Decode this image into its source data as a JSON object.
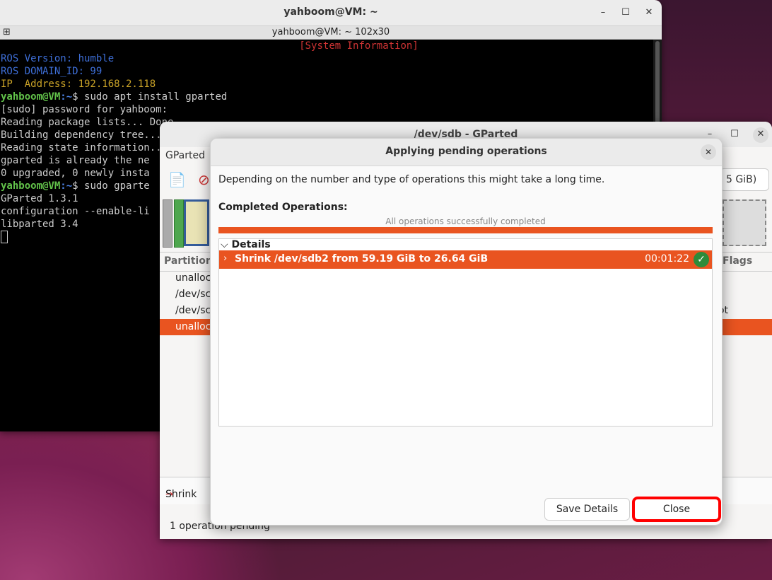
{
  "terminal": {
    "window_title": "yahboom@VM: ~",
    "tab_title": "yahboom@VM: ~ 102x30",
    "window_controls": {
      "minimize": "–",
      "maximize": "☐",
      "close": "✕"
    },
    "lines": {
      "sys_info": "[System Information]",
      "ros_version": "ROS Version: humble",
      "ros_domain": "ROS DOMAIN_ID: 99",
      "ip": "IP  Address: 192.168.2.118",
      "prompt1_user": "yahboom@VM",
      "prompt1_path": ":~",
      "prompt1_cmd": "$ sudo apt install gparted",
      "l1": "[sudo] password for yahboom:",
      "l2": "Reading package lists... Done",
      "l3": "Building dependency tree...",
      "l4": "Reading state information...",
      "l5": "gparted is already the ne",
      "l6": "0 upgraded, 0 newly insta",
      "prompt2_user": "yahboom@VM",
      "prompt2_path": ":~",
      "prompt2_cmd": "$ sudo gparte",
      "l7": "GParted 1.3.1",
      "l8": "configuration --enable-li",
      "l9": "libparted 3.4"
    }
  },
  "gparted": {
    "window_title": "/dev/sdb - GParted",
    "menu_first": "GParted",
    "device_select": "5 GiB)",
    "col_partition": "Partition",
    "col_flags": "Flags",
    "rows": [
      {
        "label": "unalloc",
        "right": ""
      },
      {
        "label": "/dev/sc",
        "right": ""
      },
      {
        "label": "/dev/sc",
        "right": "ot"
      },
      {
        "label": "unalloc",
        "right": ""
      }
    ],
    "pending_op": "Shrink",
    "status": "1 operation pending"
  },
  "dialog": {
    "title": "Applying pending operations",
    "description": "Depending on the number and type of operations this might take a long time.",
    "completed_label": "Completed Operations:",
    "progress_text": "All operations successfully completed",
    "progress": 1.0,
    "details_label": "Details",
    "operation": {
      "label": "Shrink /dev/sdb2 from 59.19 GiB to 26.64 GiB",
      "time": "00:01:22"
    },
    "buttons": {
      "save_details": "Save Details",
      "close": "Close"
    }
  },
  "colors": {
    "accent": "#e95420",
    "highlight_outline": "#ff0000",
    "success": "#2e8b3a"
  }
}
